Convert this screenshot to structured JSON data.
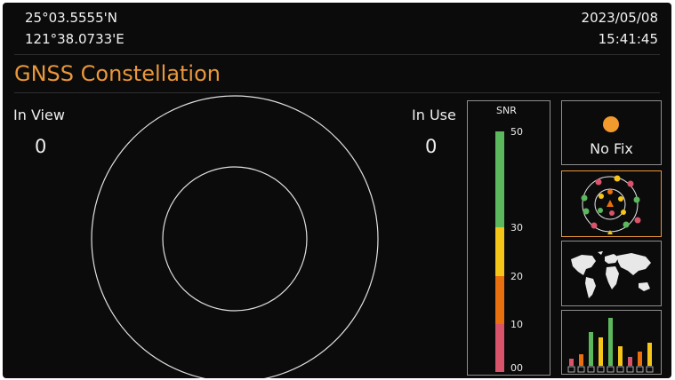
{
  "header": {
    "latitude": "25°03.5555'N",
    "longitude": "121°38.0733'E",
    "date": "2023/05/08",
    "time": "15:41:45"
  },
  "title": "GNSS Constellation",
  "in_view": {
    "label": "In View",
    "value": "0"
  },
  "in_use": {
    "label": "In Use",
    "value": "0"
  },
  "snr": {
    "label": "SNR",
    "ticks": [
      "50",
      "30",
      "20",
      "10",
      "00"
    ],
    "colors": {
      "green": "#5cb85c",
      "yellow": "#f5c518",
      "orange": "#e8700f",
      "red": "#d9536a"
    }
  },
  "fix_status": {
    "label": "No Fix",
    "dot_color": "#f29a2e"
  },
  "side_panels": [
    {
      "name": "fix-status",
      "icon": "status-dot-icon"
    },
    {
      "name": "constellation-view",
      "icon": "satellite-orbit-icon",
      "active": true
    },
    {
      "name": "world-map-view",
      "icon": "world-map-icon"
    },
    {
      "name": "snr-bars-view",
      "icon": "bar-chart-icon"
    }
  ],
  "colors": {
    "accent": "#e9973a",
    "background": "#0b0b0b",
    "border": "#8e8e8e"
  }
}
